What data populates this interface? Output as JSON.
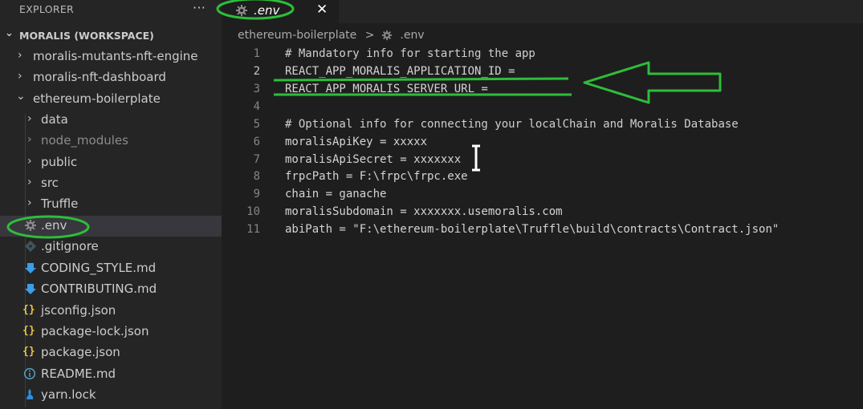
{
  "explorer": {
    "title": "EXPLORER",
    "more_label": "···",
    "workspace_label": "MORALIS (WORKSPACE)",
    "items": [
      {
        "label": "moralis-mutants-nft-engine"
      },
      {
        "label": "moralis-nft-dashboard"
      },
      {
        "label": "ethereum-boilerplate"
      },
      {
        "label": "data"
      },
      {
        "label": "node_modules"
      },
      {
        "label": "public"
      },
      {
        "label": "src"
      },
      {
        "label": "Truffle"
      },
      {
        "label": ".env"
      },
      {
        "label": ".gitignore"
      },
      {
        "label": "CODING_STYLE.md"
      },
      {
        "label": "CONTRIBUTING.md"
      },
      {
        "label": "jsconfig.json"
      },
      {
        "label": "package-lock.json"
      },
      {
        "label": "package.json"
      },
      {
        "label": "README.md"
      },
      {
        "label": "yarn.lock"
      }
    ]
  },
  "tab": {
    "name": ".env",
    "close_label": "✕"
  },
  "breadcrumb": {
    "folder": "ethereum-boilerplate",
    "separator": ">",
    "file": ".env"
  },
  "editor": {
    "lines": [
      {
        "num": "1",
        "text": "# Mandatory info for starting the app"
      },
      {
        "num": "2",
        "text": "REACT_APP_MORALIS_APPLICATION_ID ="
      },
      {
        "num": "3",
        "text": "REACT_APP_MORALIS_SERVER_URL ="
      },
      {
        "num": "4",
        "text": ""
      },
      {
        "num": "5",
        "text": "# Optional info for connecting your localChain and Moralis Database"
      },
      {
        "num": "6",
        "text": "moralisApiKey = xxxxx"
      },
      {
        "num": "7",
        "text": "moralisApiSecret = xxxxxxx"
      },
      {
        "num": "8",
        "text": "frpcPath = F:\\frpc\\frpc.exe"
      },
      {
        "num": "9",
        "text": "chain = ganache"
      },
      {
        "num": "10",
        "text": "moralisSubdomain = xxxxxxx.usemoralis.com"
      },
      {
        "num": "11",
        "text": "abiPath = \"F:\\ethereum-boilerplate\\Truffle\\build\\contracts\\Contract.json\""
      }
    ],
    "current_line": "2"
  },
  "colors": {
    "annotation_green": "#2ebd3a",
    "json_icon": "#e8c547",
    "md_icon": "#3a9ee8",
    "info_icon": "#519aba",
    "yarn_icon": "#2f8ddb"
  }
}
